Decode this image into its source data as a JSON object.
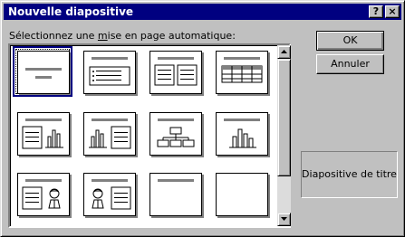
{
  "window": {
    "title": "Nouvelle diapositive",
    "help_glyph": "?",
    "close_glyph": "×"
  },
  "layout_list": {
    "label_prefix": "Sélectionnez une ",
    "label_mnemonic": "m",
    "label_suffix": "ise en page automatique:",
    "selected_index": 0,
    "layouts": [
      "title",
      "bulleted-list",
      "two-column-text",
      "table",
      "text-and-chart",
      "chart-and-text",
      "organization-chart",
      "chart",
      "text-and-clip-art",
      "clip-art-and-text",
      "title-only",
      "blank"
    ]
  },
  "buttons": {
    "ok": "OK",
    "cancel": "Annuler"
  },
  "description": {
    "text": "Diapositive de titre"
  },
  "icons": {
    "scroll_up": "triangle-up-icon",
    "scroll_down": "triangle-down-icon"
  },
  "colors": {
    "titlebar": "#000080",
    "face": "#c0c0c0",
    "selection": "#000080"
  }
}
